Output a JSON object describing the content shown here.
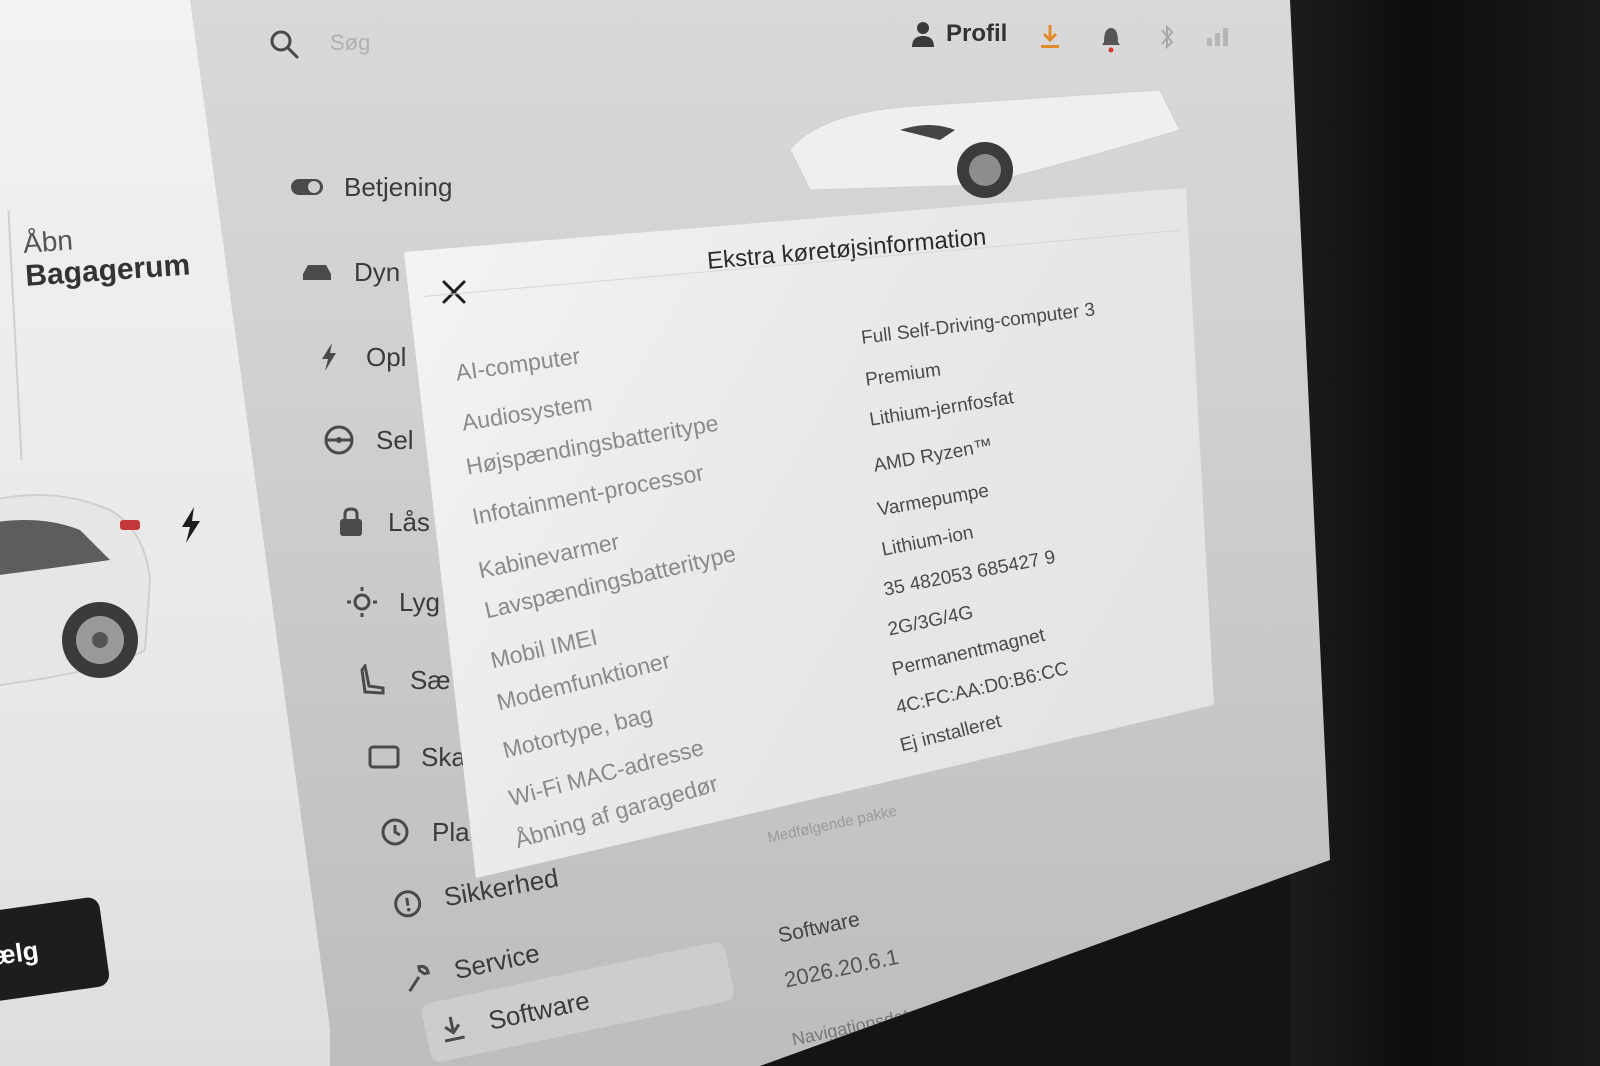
{
  "colors": {
    "screen_bg": "#d9d9d9",
    "modal_bg": "#ededed",
    "text_dark": "#333333",
    "label_gray": "#8a8a8a",
    "accent_orange": "#e38b2c",
    "accent_red": "#d83a34",
    "link_blue": "#3a6cd0"
  },
  "left_panel": {
    "trunk_line1": "Åbn",
    "trunk_line2": "Bagagerum",
    "button_text": "ælg"
  },
  "topbar": {
    "search_placeholder": "Søg",
    "profile_label": "Profil"
  },
  "menu": {
    "items": [
      {
        "label": "Betjening",
        "icon": "toggle-icon"
      },
      {
        "label": "Dyn",
        "icon": "car-icon"
      },
      {
        "label": "Opl",
        "icon": "bolt-icon"
      },
      {
        "label": "Sel",
        "icon": "steering-wheel-icon"
      },
      {
        "label": "Lås",
        "icon": "lock-icon"
      },
      {
        "label": "Lyg",
        "icon": "sun-icon"
      },
      {
        "label": "Sæ",
        "icon": "seat-icon"
      },
      {
        "label": "Ska",
        "icon": "screen-icon"
      },
      {
        "label": "Pla",
        "icon": "clock-icon"
      },
      {
        "label": "Sikkerhed",
        "icon": "info-icon"
      },
      {
        "label": "Service",
        "icon": "wrench-icon"
      },
      {
        "label": "Software",
        "icon": "download-icon"
      }
    ]
  },
  "main_content": {
    "included_packages": "Medfølgende pakke",
    "software_heading": "Software",
    "software_version": "2026.20.6.1",
    "navigation_data": "Navigationsdata"
  },
  "modal": {
    "title": "Ekstra køretøjsinformation",
    "specs": [
      {
        "label": "AI-computer",
        "value": "Full Self-Driving-computer 3"
      },
      {
        "label": "Audiosystem",
        "value": "Premium"
      },
      {
        "label": "Højspændingsbatteritype",
        "value": "Lithium-jernfosfat"
      },
      {
        "label": "Infotainment-processor",
        "value": "AMD Ryzen™"
      },
      {
        "label": "Kabinevarmer",
        "value": "Varmepumpe"
      },
      {
        "label": "Lavspændingsbatteritype",
        "value": "Lithium-ion"
      },
      {
        "label": "Mobil IMEI",
        "value": "35 482053 685427 9"
      },
      {
        "label": "Modemfunktioner",
        "value": "2G/3G/4G"
      },
      {
        "label": "Motortype, bag",
        "value": "Permanentmagnet"
      },
      {
        "label": "Wi-Fi MAC-adresse",
        "value": "4C:FC:AA:D0:B6:CC"
      },
      {
        "label": "Åbning af garagedør",
        "value": "Ej installeret"
      }
    ]
  }
}
